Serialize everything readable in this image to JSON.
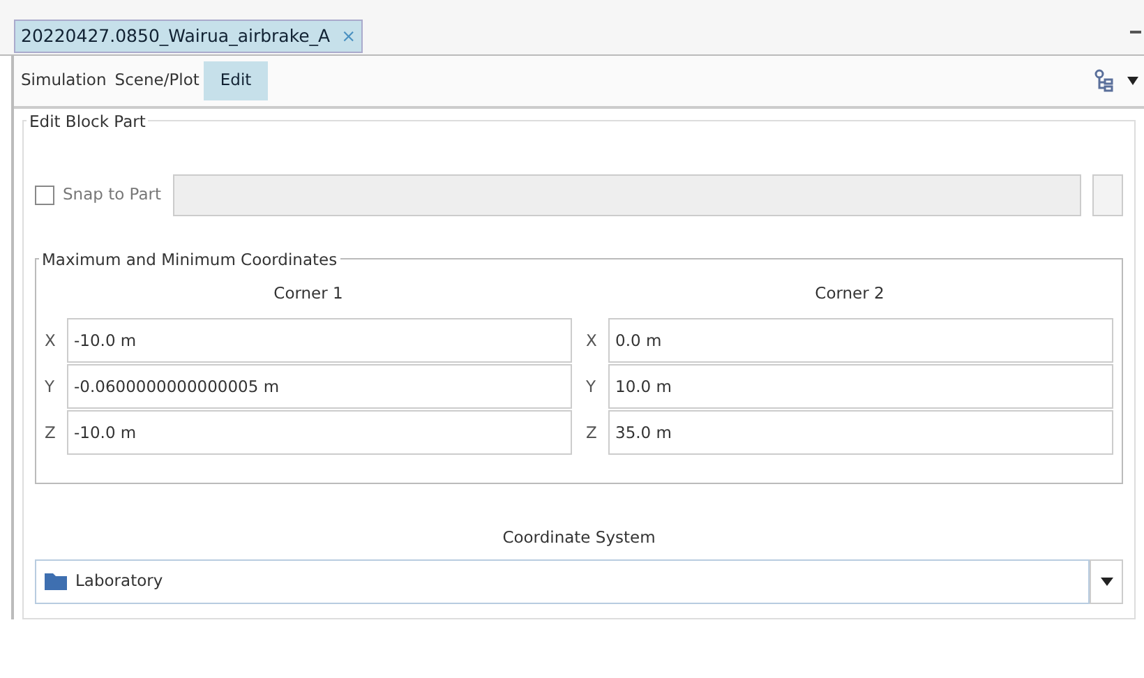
{
  "tab": {
    "title": "20220427.0850_Wairua_airbrake_A",
    "close": "×"
  },
  "menu": [
    {
      "label": "Simulation",
      "selected": false
    },
    {
      "label": "Scene/Plot",
      "selected": false
    },
    {
      "label": "Edit",
      "selected": true
    }
  ],
  "group": {
    "title": "Edit Block Part",
    "snap": {
      "label": "Snap to Part",
      "checked": false,
      "disabled": true
    },
    "coords": {
      "title": "Maximum and Minimum Coordinates",
      "corners": [
        {
          "title": "Corner 1",
          "rows": [
            {
              "axis": "X",
              "value": "-10.0 m"
            },
            {
              "axis": "Y",
              "value": "-0.0600000000000005 m"
            },
            {
              "axis": "Z",
              "value": "-10.0 m"
            }
          ]
        },
        {
          "title": "Corner 2",
          "rows": [
            {
              "axis": "X",
              "value": "0.0 m"
            },
            {
              "axis": "Y",
              "value": "10.0 m"
            },
            {
              "axis": "Z",
              "value": "35.0 m"
            }
          ]
        }
      ]
    },
    "coordinate_system": {
      "label": "Coordinate System",
      "value": "Laboratory"
    }
  }
}
